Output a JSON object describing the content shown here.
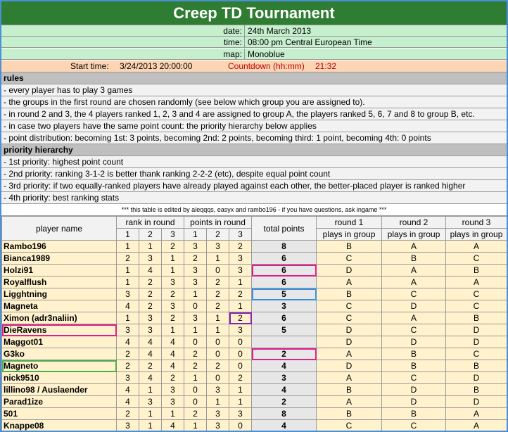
{
  "title": "Creep TD Tournament",
  "info": {
    "date_label": "date:",
    "date_value": "24th March 2013",
    "time_label": "time:",
    "time_value": "08:00 pm Central European Time",
    "map_label": "map:",
    "map_value": "Monoblue"
  },
  "start": {
    "label": "Start time:",
    "value": "3/24/2013 20:00:00",
    "countdown_label": "Countdown (hh:mm)",
    "countdown_value": "21:32"
  },
  "rules": {
    "heading": "rules",
    "items": [
      "- every player has to play 3 games",
      "- the groups in the first round are chosen randomly (see below which group you are assigned to).",
      "- in round 2 and 3, the 4 players ranked 1, 2, 3 and 4 are assigned to group A, the players ranked 5, 6, 7 and 8 to group B, etc.",
      "- in case two players have the same point count: the priority hierarchy below applies",
      "- point distribution: becoming 1st: 3 points, becoming 2nd: 2 points, becoming third: 1 point, becoming 4th: 0 points"
    ]
  },
  "priority": {
    "heading": "priority hierarchy",
    "items": [
      "- 1st priority: highest point count",
      "- 2nd priority: ranking 3-1-2 is better thank ranking 2-2-2 (etc), despite equal point count",
      "- 3rd priority: if two equally-ranked players have already played against each other, the better-placed player is ranked higher",
      "- 4th priority: best ranking stats"
    ]
  },
  "note": "*** this table is edited by aleqqqs, easyx and rambo196 - if you have questions, ask ingame ***",
  "table": {
    "headers": {
      "player": "player name",
      "rank": "rank in round",
      "points": "points in round",
      "total": "total points",
      "r1": "round 1",
      "r2": "round 2",
      "r3": "round 3",
      "sub1": "1",
      "sub2": "2",
      "sub3": "3",
      "plays": "plays in group"
    },
    "rows": [
      {
        "name": "Rambo196",
        "rank": [
          "1",
          "1",
          "2"
        ],
        "pts": [
          "3",
          "3",
          "2"
        ],
        "total": "8",
        "g": [
          "B",
          "A",
          "A"
        ]
      },
      {
        "name": "Bianca1989",
        "rank": [
          "2",
          "3",
          "1"
        ],
        "pts": [
          "2",
          "1",
          "3"
        ],
        "total": "6",
        "g": [
          "C",
          "B",
          "C"
        ]
      },
      {
        "name": "Holzi91",
        "rank": [
          "1",
          "4",
          "1"
        ],
        "pts": [
          "3",
          "0",
          "3"
        ],
        "total": "6",
        "g": [
          "D",
          "A",
          "B"
        ]
      },
      {
        "name": "Royalflush",
        "rank": [
          "1",
          "2",
          "3"
        ],
        "pts": [
          "3",
          "2",
          "1"
        ],
        "total": "6",
        "g": [
          "A",
          "A",
          "A"
        ]
      },
      {
        "name": "Ligghtning",
        "rank": [
          "3",
          "2",
          "2"
        ],
        "pts": [
          "1",
          "2",
          "2"
        ],
        "total": "5",
        "g": [
          "B",
          "C",
          "C"
        ]
      },
      {
        "name": "Magneta",
        "rank": [
          "4",
          "2",
          "3"
        ],
        "pts": [
          "0",
          "2",
          "1"
        ],
        "total": "3",
        "g": [
          "C",
          "D",
          "C"
        ]
      },
      {
        "name": "Ximon (adr3naliin)",
        "rank": [
          "1",
          "3",
          "2"
        ],
        "pts": [
          "3",
          "1",
          "2"
        ],
        "total": "6",
        "g": [
          "C",
          "A",
          "B"
        ]
      },
      {
        "name": "DieRavens",
        "rank": [
          "3",
          "3",
          "1"
        ],
        "pts": [
          "1",
          "1",
          "3"
        ],
        "total": "5",
        "g": [
          "D",
          "C",
          "D"
        ]
      },
      {
        "name": "Maggot01",
        "rank": [
          "4",
          "4",
          "4"
        ],
        "pts": [
          "0",
          "0",
          "0"
        ],
        "total": "",
        "g": [
          "D",
          "D",
          "D"
        ]
      },
      {
        "name": "G3ko",
        "rank": [
          "2",
          "4",
          "4"
        ],
        "pts": [
          "2",
          "0",
          "0"
        ],
        "total": "2",
        "g": [
          "A",
          "B",
          "C"
        ]
      },
      {
        "name": "Magneto",
        "rank": [
          "2",
          "2",
          "4"
        ],
        "pts": [
          "2",
          "2",
          "0"
        ],
        "total": "4",
        "g": [
          "D",
          "B",
          "B"
        ]
      },
      {
        "name": "nick9510",
        "rank": [
          "3",
          "4",
          "2"
        ],
        "pts": [
          "1",
          "0",
          "2"
        ],
        "total": "3",
        "g": [
          "A",
          "C",
          "D"
        ]
      },
      {
        "name": "lillino98 / Auslaender",
        "rank": [
          "4",
          "1",
          "3"
        ],
        "pts": [
          "0",
          "3",
          "1"
        ],
        "total": "4",
        "g": [
          "B",
          "D",
          "B"
        ]
      },
      {
        "name": "Parad1ize",
        "rank": [
          "4",
          "3",
          "3"
        ],
        "pts": [
          "0",
          "1",
          "1"
        ],
        "total": "2",
        "g": [
          "A",
          "D",
          "D"
        ]
      },
      {
        "name": "501",
        "rank": [
          "2",
          "1",
          "1"
        ],
        "pts": [
          "2",
          "3",
          "3"
        ],
        "total": "8",
        "g": [
          "B",
          "B",
          "A"
        ]
      },
      {
        "name": "Knappe08",
        "rank": [
          "3",
          "1",
          "4"
        ],
        "pts": [
          "1",
          "3",
          "0"
        ],
        "total": "4",
        "g": [
          "C",
          "C",
          "A"
        ]
      }
    ]
  },
  "colors": {
    "title_bg": "#2e7d32",
    "info_bg": "#c6efce",
    "start_bg": "#fcd5b4",
    "countdown": "#c00000",
    "row_bg": "#fff2cc",
    "highlight_pink": "#e01e8c",
    "highlight_green": "#4caf50",
    "highlight_blue": "#3c8fe0"
  }
}
